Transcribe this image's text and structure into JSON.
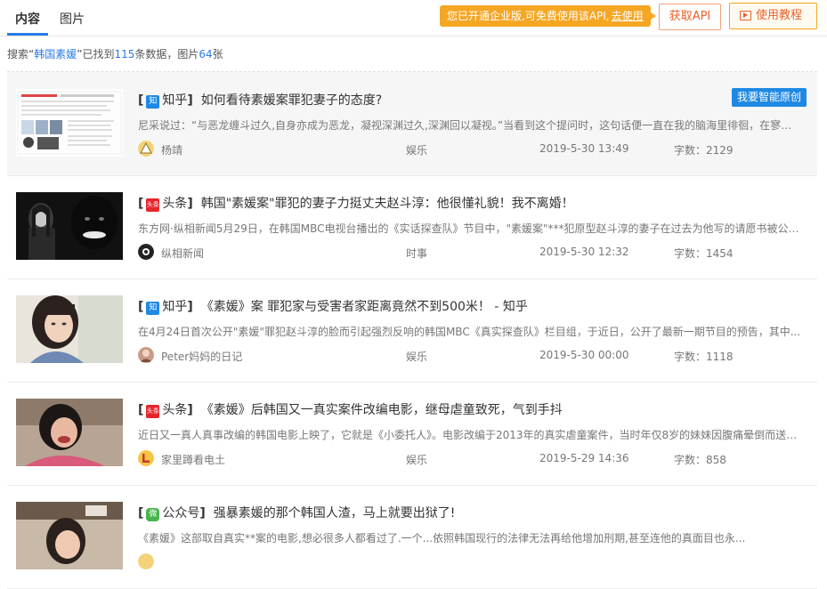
{
  "tabs": [
    {
      "label": "内容",
      "active": true
    },
    {
      "label": "图片",
      "active": false
    }
  ],
  "promo": {
    "text": "您已开通企业版,可免费使用该API,",
    "link": "去使用"
  },
  "buttons": {
    "api": "获取API",
    "tutorial": "使用教程"
  },
  "summary": {
    "prefix": "搜索“",
    "keyword": "韩国素媛",
    "mid1": "”已找到",
    "count": "115",
    "mid2": "条数据，图片",
    "images": "64",
    "suffix": "张"
  },
  "items": [
    {
      "source_icon": "知",
      "source": "知乎",
      "title": "如何看待素媛案罪犯妻子的态度?",
      "excerpt": "尼采说过：“与恶龙缠斗过久,自身亦成为恶龙，凝视深渊过久,深渊回以凝视。”当看到这个提问时，这句话便一直在我的脑海里徘徊，在寥寥...",
      "author": "杨靖",
      "category": "娱乐",
      "time": "2019-5-30 13:49",
      "words": "字数：2129",
      "badge": "我要智能原创"
    },
    {
      "source_icon": "头条",
      "source": "头条",
      "title": "韩国\"素媛案\"罪犯的妻子力挺丈夫赵斗淳：他很懂礼貌！我不离婚！",
      "excerpt": "东方网·纵相新闻5月29日，在韩国MBC电视台播出的《实话探查队》节目中，\"素媛案\"***犯原型赵斗淳的妻子在过去为他写的请愿书被公开。",
      "author": "纵相新闻",
      "category": "时事",
      "time": "2019-5-30 12:32",
      "words": "字数：1454"
    },
    {
      "source_icon": "知",
      "source": "知乎",
      "title": "《素媛》案 罪犯家与受害者家距离竟然不到500米！ - 知乎",
      "excerpt": "在4月24日首次公开\"素媛\"罪犯赵斗淳的脸而引起强烈反响的韩国MBC《真实探查队》栏目组，于近日，公开了最新一期节目的预告，其中...",
      "author": "Peter妈妈的日记",
      "category": "娱乐",
      "time": "2019-5-30 00:00",
      "words": "字数：1118"
    },
    {
      "source_icon": "头条",
      "source": "头条",
      "title": "《素媛》后韩国又一真实案件改编电影，继母虐童致死，气到手抖",
      "excerpt": "近日又一真人真事改编的韩国电影上映了，它就是《小委托人》。电影改编于2013年的真实虐童案件，当时年仅8岁的妹妹因腹痛晕倒而送医...",
      "author": "家里蹲看电土",
      "category": "娱乐",
      "time": "2019-5-29 14:36",
      "words": "字数：858"
    },
    {
      "source_icon": "微",
      "source": "公众号",
      "title": "强暴素媛的那个韩国人渣，马上就要出狱了!",
      "excerpt": "《素媛》这部取自真实**案的电影,想必很多人都看过了.一个...依照韩国现行的法律无法再给他增加刑期,甚至连他的真面目也永...",
      "author": "",
      "category": "",
      "time": "",
      "words": ""
    }
  ],
  "colors": {
    "accent": "#2c7be5",
    "promo": "#f5a623",
    "api_text": "#e8612c",
    "zhihu": "#1e89e4",
    "toutiao": "#e6252b",
    "wechat": "#44b549"
  }
}
